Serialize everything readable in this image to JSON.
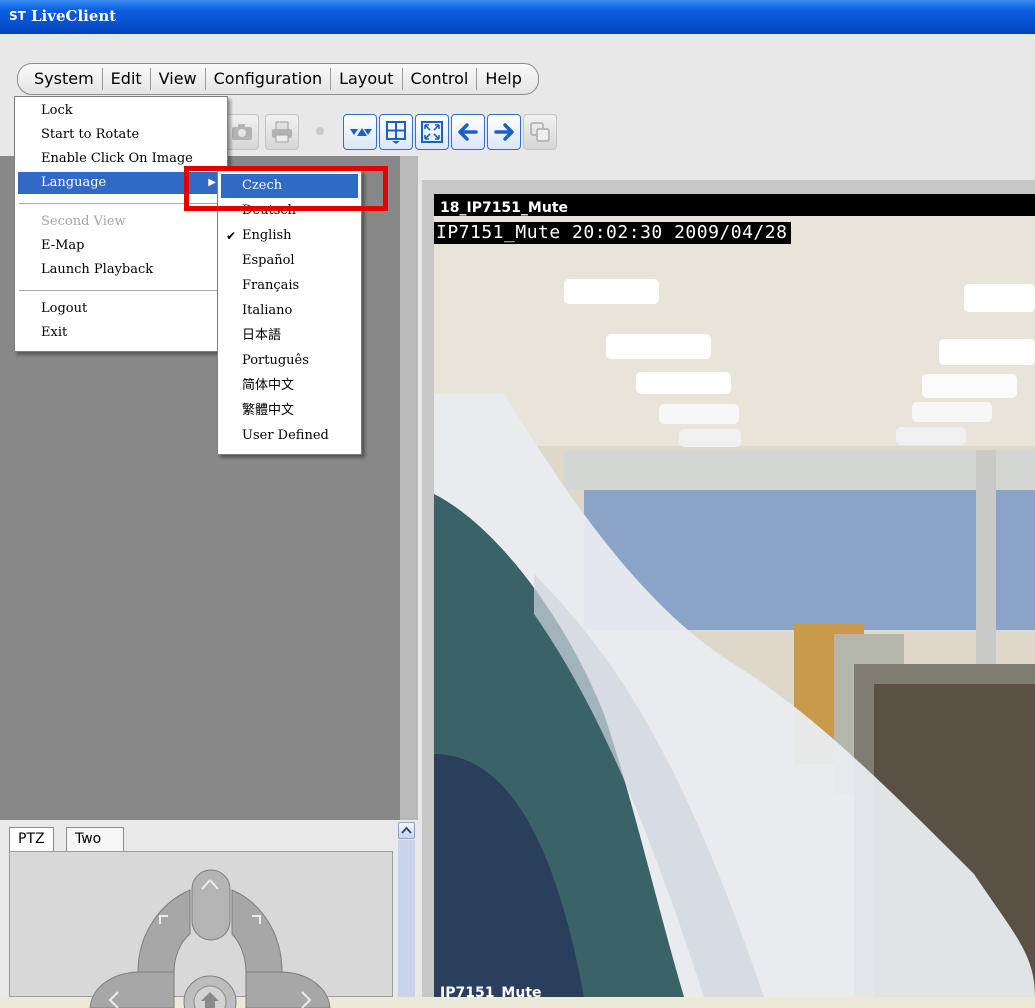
{
  "window": {
    "title": "LiveClient",
    "app_icon_text": "ST"
  },
  "menubar": {
    "items": [
      "System",
      "Edit",
      "View",
      "Configuration",
      "Layout",
      "Control",
      "Help"
    ]
  },
  "toolbar": {
    "buttons": [
      {
        "icon": "camera-icon",
        "enabled": false
      },
      {
        "icon": "printer-icon",
        "enabled": false
      },
      {
        "icon": "record-icon",
        "enabled": false
      },
      {
        "icon": "layout-switch-icon",
        "enabled": true
      },
      {
        "icon": "grid-layout-icon",
        "enabled": true
      },
      {
        "icon": "fullscreen-icon",
        "enabled": true
      },
      {
        "icon": "arrow-left-icon",
        "enabled": true
      },
      {
        "icon": "arrow-right-icon",
        "enabled": true
      },
      {
        "icon": "copy-view-icon",
        "enabled": false
      }
    ]
  },
  "system_menu": {
    "items": [
      {
        "label": "Lock",
        "enabled": true
      },
      {
        "label": "Start to Rotate",
        "enabled": true
      },
      {
        "label": "Enable Click On Image",
        "enabled": true
      },
      {
        "label": "Language",
        "enabled": true,
        "submenu": true,
        "highlighted": true
      },
      {
        "label": "Second View",
        "enabled": false
      },
      {
        "label": "E-Map",
        "enabled": true
      },
      {
        "label": "Launch Playback",
        "enabled": true
      },
      {
        "label": "Logout",
        "enabled": true
      },
      {
        "label": "Exit",
        "enabled": true
      }
    ]
  },
  "language_submenu": {
    "items": [
      {
        "label": "Czech",
        "highlighted": true,
        "checked": false
      },
      {
        "label": "Deutsch",
        "highlighted": false,
        "checked": false
      },
      {
        "label": "English",
        "highlighted": false,
        "checked": true
      },
      {
        "label": "Español",
        "highlighted": false,
        "checked": false
      },
      {
        "label": "Français",
        "highlighted": false,
        "checked": false
      },
      {
        "label": "Italiano",
        "highlighted": false,
        "checked": false
      },
      {
        "label": "日本語",
        "highlighted": false,
        "checked": false
      },
      {
        "label": "Português",
        "highlighted": false,
        "checked": false
      },
      {
        "label": "简体中文",
        "highlighted": false,
        "checked": false
      },
      {
        "label": "繁體中文",
        "highlighted": false,
        "checked": false
      },
      {
        "label": "User Defined",
        "highlighted": false,
        "checked": false
      }
    ]
  },
  "video": {
    "camera_name": "18_IP7151_Mute",
    "osd_text": "IP7151_Mute 20:02:30 2009/04/28",
    "bottom_name": "IP7151_Mute"
  },
  "bottom_panel": {
    "tabs": [
      "PTZ",
      "Two Way Audio"
    ],
    "active_tab": "PTZ"
  },
  "colors": {
    "titlebar": "#0a5fe0",
    "highlight": "#3169c6",
    "annotation": "#e50000"
  }
}
